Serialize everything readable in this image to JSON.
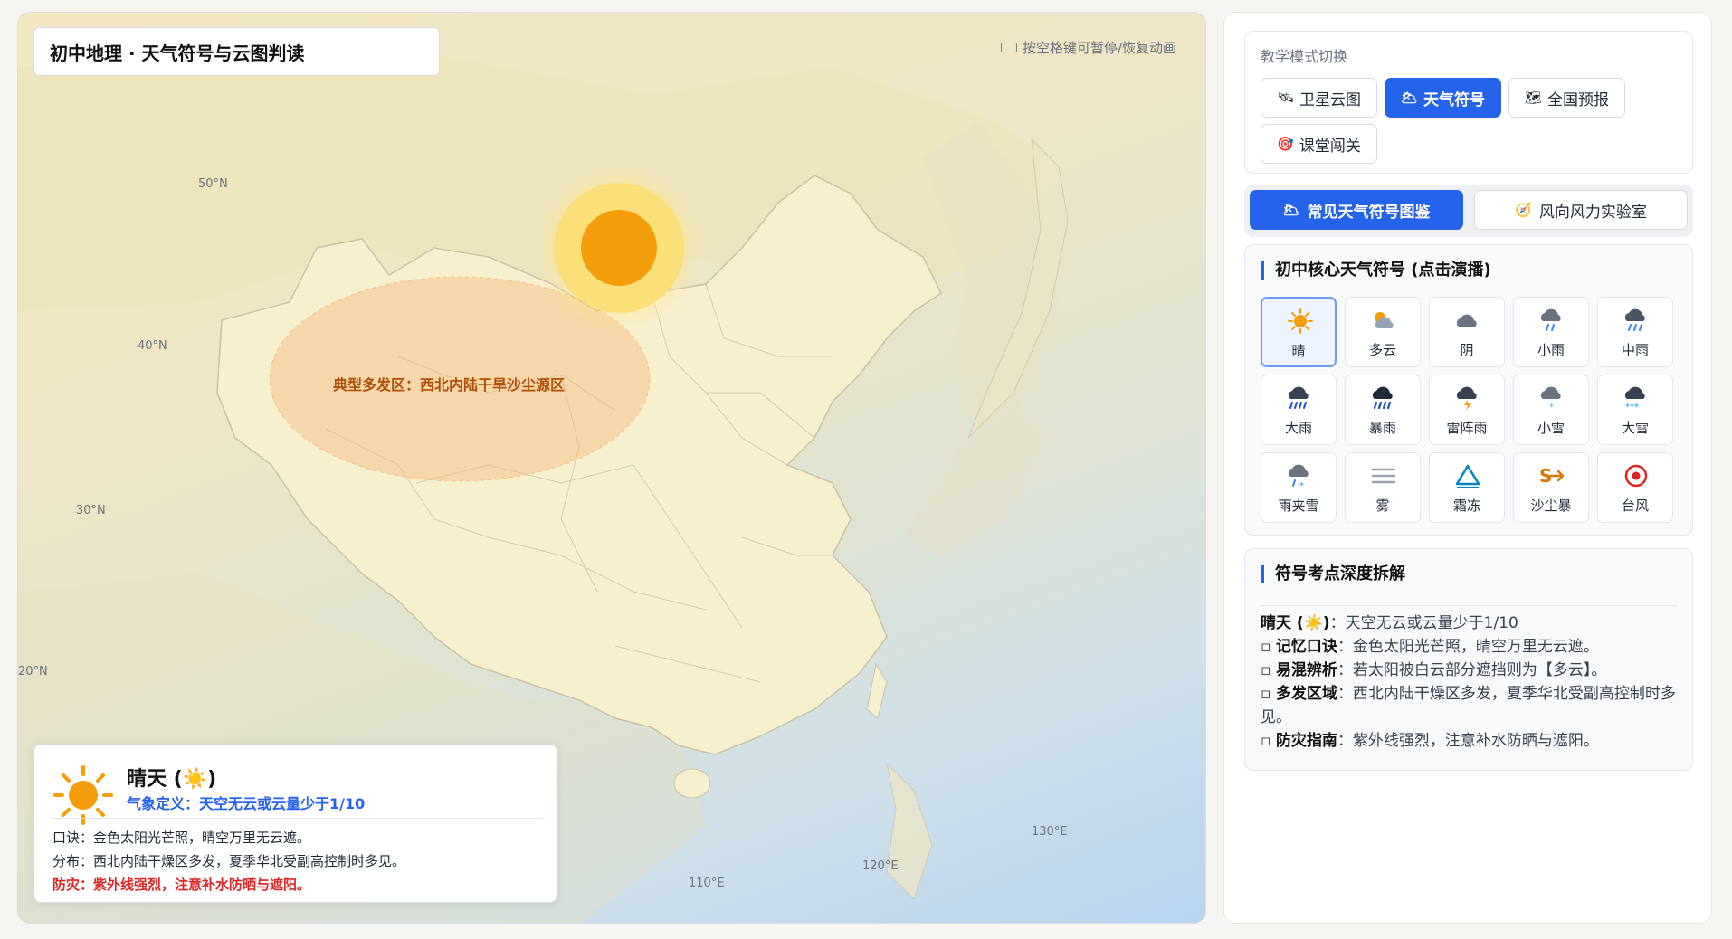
{
  "map": {
    "title": "初中地理 · 天气符号与云图判读",
    "hint": "按空格键可暂停/恢复动画",
    "lat_labels": [
      "50°N",
      "40°N",
      "30°N",
      "20°N"
    ],
    "lon_labels": [
      "110°E",
      "120°E",
      "130°E"
    ],
    "dust_zone_label": "典型多发区：西北内陆干旱沙尘源区",
    "info_card": {
      "title": "晴天 (☀️)",
      "definition": "气象定义：天空无云或云量少于1/10",
      "mnemonic": "口诀：金色太阳光芒照，晴空万里无云遮。",
      "distribution": "分布：西北内陆干燥区多发，夏季华北受副高控制时多见。",
      "warning": "防灾：紫外线强烈，注意补水防晒与遮阳。"
    }
  },
  "side": {
    "mode_label": "教学模式切换",
    "modes": [
      {
        "icon": "🛰",
        "label": "卫星云图",
        "active": false
      },
      {
        "icon": "🌥",
        "label": "天气符号",
        "active": true
      },
      {
        "icon": "🗺",
        "label": "全国预报",
        "active": false
      },
      {
        "icon": "🎯",
        "label": "课堂闯关",
        "active": false
      }
    ],
    "subtabs": [
      {
        "icon": "🌥",
        "label": "常见天气符号图鉴",
        "active": true
      },
      {
        "icon": "🧭",
        "label": "风向风力实验室",
        "active": false
      }
    ],
    "grid_title": "初中核心天气符号 (点击演播)",
    "symbols": [
      {
        "label": "晴",
        "icon": "sun-icon"
      },
      {
        "label": "多云",
        "icon": "partly-cloudy-icon"
      },
      {
        "label": "阴",
        "icon": "overcast-icon"
      },
      {
        "label": "小雨",
        "icon": "light-rain-icon"
      },
      {
        "label": "中雨",
        "icon": "moderate-rain-icon"
      },
      {
        "label": "大雨",
        "icon": "heavy-rain-icon"
      },
      {
        "label": "暴雨",
        "icon": "rainstorm-icon"
      },
      {
        "label": "雷阵雨",
        "icon": "thunderstorm-icon"
      },
      {
        "label": "小雪",
        "icon": "light-snow-icon"
      },
      {
        "label": "大雪",
        "icon": "heavy-snow-icon"
      },
      {
        "label": "雨夹雪",
        "icon": "sleet-icon"
      },
      {
        "label": "雾",
        "icon": "fog-icon"
      },
      {
        "label": "霜冻",
        "icon": "frost-icon"
      },
      {
        "label": "沙尘暴",
        "icon": "sandstorm-icon"
      },
      {
        "label": "台风",
        "icon": "typhoon-icon"
      }
    ],
    "selected_symbol": "晴",
    "detail_title": "符号考点深度拆解",
    "detail": {
      "head_term": "晴天 (☀️)",
      "head_text": "：天空无云或云量少于1/10",
      "items": [
        {
          "term": "记忆口诀",
          "text": "：金色太阳光芒照，晴空万里无云遮。"
        },
        {
          "term": "易混辨析",
          "text": "：若太阳被白云部分遮挡则为【多云】。"
        },
        {
          "term": "多发区域",
          "text": "：西北内陆干燥区多发，夏季华北受副高控制时多见。"
        },
        {
          "term": "防灾指南",
          "text": "：紫外线强烈，注意补水防晒与遮阳。"
        }
      ]
    }
  },
  "colors": {
    "accent": "#2563eb",
    "sun": "#f59e0b",
    "warning": "#dc2626",
    "dust_label": "#b04e0a"
  }
}
